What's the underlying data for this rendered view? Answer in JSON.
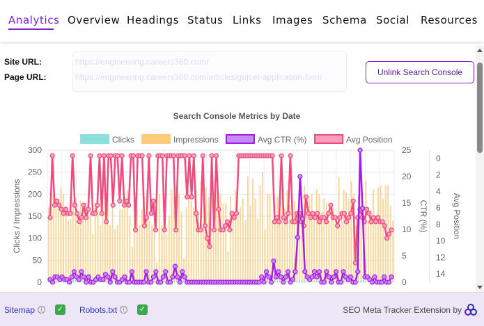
{
  "nav": {
    "tabs": [
      {
        "label": "Analytics",
        "active": true
      },
      {
        "label": "Overview"
      },
      {
        "label": "Headings"
      },
      {
        "label": "Status"
      },
      {
        "label": "Links"
      },
      {
        "label": "Images"
      },
      {
        "label": "Schema"
      },
      {
        "label": "Social"
      },
      {
        "label": "Resources"
      }
    ]
  },
  "info": {
    "site_label": "Site URL:",
    "site_url": "https://engineering.careers360.com/",
    "page_label": "Page URL:",
    "page_url": "https://engineering.careers360.com/articles/gujcet-application-form",
    "unlink_button": "Unlink Search Console"
  },
  "chart_data": {
    "type": "line",
    "title": "Search Console Metrics by Date",
    "legend": [
      "Clicks",
      "Impressions",
      "Avg CTR (%)",
      "Avg Position"
    ],
    "legend_position": "top",
    "colors": {
      "clicks": "#8fdede",
      "impressions": "#fdcb7c",
      "ctr": "#a21ee6",
      "position": "#f04a7e"
    },
    "y_left": {
      "label": "Clicks / Impressions",
      "ticks": [
        0,
        50,
        100,
        150,
        200,
        250,
        300
      ],
      "range": [
        0,
        300
      ]
    },
    "y_ctr": {
      "label": "CTR (%)",
      "ticks": [
        0,
        5,
        10,
        15,
        20,
        25
      ],
      "range": [
        0,
        25
      ]
    },
    "y_position": {
      "label": "Avg Position",
      "ticks": [
        0,
        2,
        4,
        6,
        8,
        10,
        12,
        14
      ],
      "range": [
        0,
        15
      ],
      "reversed": true
    },
    "impressions": [
      170,
      195,
      200,
      190,
      190,
      215,
      200,
      165,
      140,
      145,
      185,
      190,
      130,
      185,
      165,
      180,
      185,
      155,
      110,
      180,
      165,
      130,
      205,
      210,
      190,
      130,
      195,
      120,
      130,
      165,
      165,
      195,
      210,
      150,
      80,
      195,
      165,
      130,
      165,
      195,
      210,
      140,
      130,
      175,
      45,
      200,
      130,
      140,
      110,
      150,
      210,
      195,
      220,
      200,
      160,
      55,
      170,
      210,
      185,
      170,
      210,
      160,
      230,
      190,
      215,
      195,
      210,
      140,
      200,
      180,
      200,
      180,
      180,
      70,
      195,
      160,
      210,
      150,
      170,
      190,
      140,
      240,
      175,
      235,
      190,
      145,
      220,
      250,
      120,
      200,
      200,
      140,
      180,
      195,
      195,
      240,
      170,
      210,
      175,
      140,
      185,
      150,
      190,
      195,
      220,
      160,
      190,
      200,
      150,
      210,
      200,
      160,
      190,
      180,
      140,
      170,
      170,
      140,
      240,
      150,
      210,
      205,
      190,
      230,
      200,
      130,
      195,
      150,
      145,
      230,
      140,
      165,
      210,
      150,
      215,
      220,
      190,
      220,
      220,
      175,
      140
    ],
    "clicks": [
      2,
      3,
      5,
      3,
      3,
      5,
      3,
      4,
      4,
      3,
      5,
      4,
      4,
      3,
      3,
      5,
      3,
      4,
      3,
      3,
      3,
      4,
      3,
      4,
      4,
      3,
      5,
      3,
      3,
      4,
      3,
      3,
      4,
      3,
      5,
      3,
      3,
      5,
      5,
      4,
      3,
      4,
      3,
      3,
      4,
      4,
      5,
      4,
      3,
      4,
      3,
      4,
      3,
      3,
      4,
      5,
      3,
      4,
      3,
      5,
      3,
      5,
      3,
      3,
      5,
      3,
      3,
      4,
      4,
      4,
      4,
      3,
      3,
      4,
      5,
      4,
      3,
      4,
      3,
      4,
      4,
      3,
      3,
      4,
      4,
      3,
      5,
      5,
      3,
      4,
      3,
      3,
      4,
      3,
      4,
      5,
      4,
      3,
      3,
      5,
      5,
      3,
      5,
      3,
      5,
      3,
      4,
      4,
      3,
      4,
      3,
      5,
      4,
      5,
      3,
      3,
      3,
      4,
      4,
      3,
      4,
      3,
      4,
      5,
      3,
      5,
      3,
      4,
      5,
      3,
      3,
      4,
      3,
      5,
      4,
      5,
      3,
      4,
      3,
      5,
      3
    ],
    "ctr": [
      0.5,
      0,
      1,
      1,
      0.5,
      1,
      0.5,
      0.5,
      0,
      1,
      2,
      1,
      0.5,
      2,
      1,
      0,
      1,
      0,
      0,
      0.5,
      1,
      0.5,
      0.5,
      1.5,
      1,
      0,
      2,
      1,
      0,
      0,
      0.5,
      1,
      0,
      0,
      2,
      0,
      0,
      0,
      0,
      0,
      2,
      0,
      0,
      1,
      2,
      0,
      0,
      1,
      2,
      0,
      0,
      1,
      3,
      1,
      0,
      2,
      1,
      0,
      0,
      0,
      0,
      0,
      0,
      0,
      0,
      0,
      0,
      0,
      0,
      0,
      0,
      0,
      0,
      0,
      0,
      0,
      0,
      0,
      0,
      0,
      0,
      0,
      0,
      0,
      0,
      0,
      0,
      0,
      1,
      0,
      2,
      1,
      0,
      4,
      1,
      2,
      1,
      0,
      1,
      2,
      0,
      0.5,
      2,
      8.5,
      20,
      12,
      2,
      1,
      0.5,
      1,
      2,
      1,
      2,
      0,
      0,
      2,
      1,
      0,
      1,
      2,
      0,
      0,
      2,
      1,
      0.5,
      1,
      0,
      0,
      2,
      25,
      14,
      1,
      1,
      0.5,
      0,
      1,
      0,
      0,
      0,
      1,
      0,
      0,
      1
    ],
    "position": [
      7.5,
      0,
      6,
      5.5,
      6,
      6.5,
      7,
      6.5,
      7,
      7,
      0,
      6,
      7,
      8,
      7.5,
      6,
      7.5,
      6.5,
      0,
      7,
      7,
      6,
      0,
      7,
      0,
      8,
      0,
      0,
      6,
      0,
      0,
      5.5,
      0,
      6,
      5.5,
      6,
      0,
      0,
      9,
      0,
      0,
      0,
      8.5,
      7.5,
      0,
      7,
      5.5,
      9,
      0,
      0,
      0,
      9,
      0,
      0,
      0,
      0,
      9,
      0,
      0,
      0,
      0,
      5,
      0,
      5,
      0,
      7,
      9,
      9,
      0,
      8.5,
      10,
      11,
      0,
      9,
      0,
      6.5,
      9,
      9,
      8.5,
      8,
      9,
      7,
      7.5,
      7,
      0,
      0,
      0,
      0,
      0,
      0,
      0,
      0,
      0,
      0,
      0,
      0,
      0,
      0,
      0,
      0,
      8,
      7.5,
      8,
      0,
      7.5,
      8,
      7,
      0,
      8,
      8,
      7,
      7,
      8,
      8.5,
      5,
      7,
      7.5,
      7,
      7.5,
      7,
      8,
      7.5,
      7.5,
      8,
      7,
      6,
      7.5,
      7.5,
      8.5,
      7.5,
      7,
      7,
      8,
      7.5,
      7,
      5.5,
      13,
      7.5,
      6.5,
      7.5,
      8,
      6.5,
      7,
      8,
      7.5,
      8,
      7.5,
      8,
      8,
      8.5,
      10,
      9.5,
      9
    ]
  },
  "footer": {
    "sitemap_label": "Sitemap",
    "robots_label": "Robots.txt",
    "credit": "SEO Meta Tracker Extension by"
  },
  "icons": {
    "info": "info-circle-icon",
    "check": "check-box-icon",
    "logo": "tricircle-logo-icon"
  }
}
